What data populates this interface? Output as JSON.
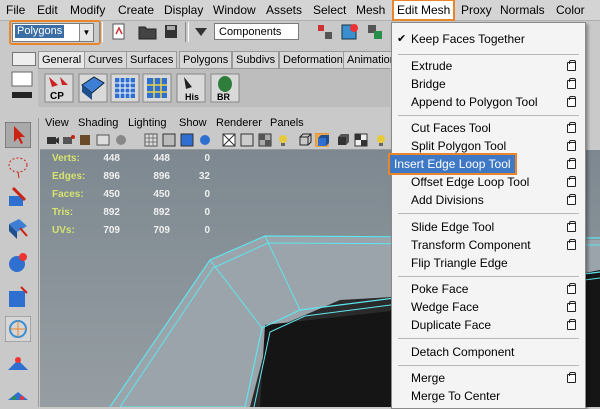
{
  "menubar": {
    "items": [
      "File",
      "Edit",
      "Modify",
      "Create",
      "Display",
      "Window",
      "Assets",
      "Select",
      "Mesh",
      "Edit Mesh",
      "Proxy",
      "Normals",
      "Color"
    ],
    "active": "Edit Mesh"
  },
  "status_line": {
    "mode_value": "Polygons",
    "selection_mask_value": "Components"
  },
  "shelf": {
    "tabs": [
      "General",
      "Curves",
      "Surfaces",
      "Polygons",
      "Subdivs",
      "Deformation",
      "Animation"
    ],
    "buttons": [
      {
        "name": "combine",
        "text": "CP"
      },
      {
        "name": "extrude-icon",
        "text": ""
      },
      {
        "name": "grid-icon",
        "text": ""
      },
      {
        "name": "uv-icon",
        "text": ""
      },
      {
        "name": "history-icon",
        "text": "His"
      },
      {
        "name": "bevel-icon",
        "text": "BR"
      }
    ]
  },
  "panel_menu": [
    "View",
    "Shading",
    "Lighting",
    "Show",
    "Renderer",
    "Panels"
  ],
  "hud": {
    "rows": [
      {
        "label": "Verts:",
        "a": "448",
        "b": "448",
        "c": "0"
      },
      {
        "label": "Edges:",
        "a": "896",
        "b": "896",
        "c": "32"
      },
      {
        "label": "Faces:",
        "a": "450",
        "b": "450",
        "c": "0"
      },
      {
        "label": "Tris:",
        "a": "892",
        "b": "892",
        "c": "0"
      },
      {
        "label": "UVs:",
        "a": "709",
        "b": "709",
        "c": "0"
      }
    ]
  },
  "dropdown": {
    "items": [
      {
        "label": "Keep Faces Together",
        "checked": true,
        "option": false
      },
      {
        "sep": true
      },
      {
        "label": "Extrude",
        "option": true
      },
      {
        "label": "Bridge",
        "option": true
      },
      {
        "label": "Append to Polygon Tool",
        "option": true
      },
      {
        "sep": true
      },
      {
        "label": "Cut Faces Tool",
        "option": true
      },
      {
        "label": "Split Polygon Tool",
        "option": true
      },
      {
        "label": "Insert Edge Loop Tool",
        "option": true,
        "highlighted": true
      },
      {
        "label": "Offset Edge Loop Tool",
        "option": true
      },
      {
        "label": "Add Divisions",
        "option": true
      },
      {
        "sep": true
      },
      {
        "label": "Slide Edge Tool",
        "option": true
      },
      {
        "label": "Transform Component",
        "option": true
      },
      {
        "label": "Flip Triangle Edge",
        "option": false
      },
      {
        "sep": true
      },
      {
        "label": "Poke Face",
        "option": true
      },
      {
        "label": "Wedge Face",
        "option": true
      },
      {
        "label": "Duplicate Face",
        "option": true
      },
      {
        "sep": true
      },
      {
        "label": "Detach Component",
        "option": false
      },
      {
        "sep": true
      },
      {
        "label": "Merge",
        "option": true
      },
      {
        "label": "Merge To Center",
        "option": false
      }
    ]
  },
  "colors": {
    "highlight_outline": "#e9862b",
    "menu_highlight": "#3f78c4",
    "mesh_edge": "#5fe6f0",
    "hud_label": "#d6e36f"
  }
}
